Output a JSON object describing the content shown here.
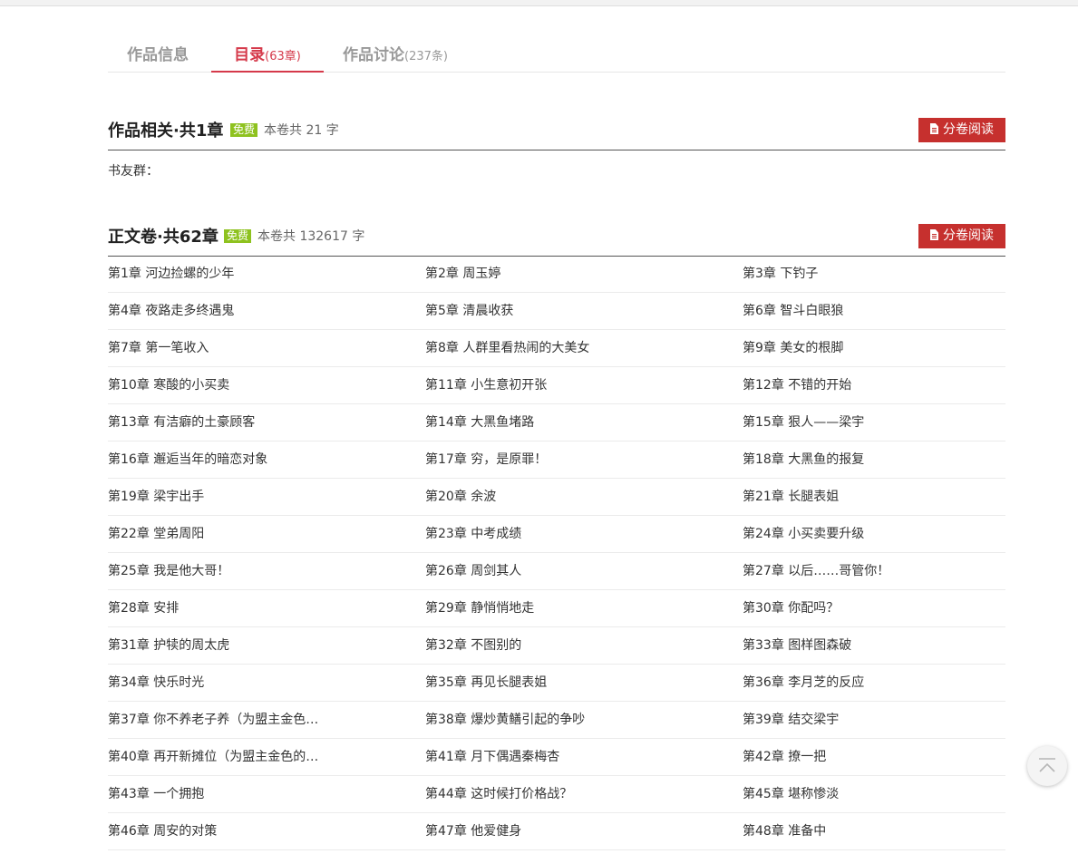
{
  "tabs": [
    {
      "label": "作品信息",
      "count": ""
    },
    {
      "label": "目录",
      "count": "(63章)"
    },
    {
      "label": "作品讨论",
      "count": "(237条)"
    }
  ],
  "volumes": [
    {
      "title": "作品相关·共1章",
      "badge": "免费",
      "info": "本卷共 21 字",
      "button": "分卷阅读",
      "note": "书友群："
    },
    {
      "title": "正文卷·共62章",
      "badge": "免费",
      "info": "本卷共 132617 字",
      "button": "分卷阅读"
    }
  ],
  "chapters": [
    "第1章 河边捡螺的少年",
    "第2章 周玉婷",
    "第3章 下钓子",
    "第4章 夜路走多终遇鬼",
    "第5章 清晨收获",
    "第6章 智斗白眼狼",
    "第7章 第一笔收入",
    "第8章 人群里看热闹的大美女",
    "第9章 美女的根脚",
    "第10章 寒酸的小买卖",
    "第11章 小生意初开张",
    "第12章 不错的开始",
    "第13章 有洁癖的土豪顾客",
    "第14章 大黑鱼堵路",
    "第15章 狠人——梁宇",
    "第16章 邂逅当年的暗恋对象",
    "第17章 穷，是原罪！",
    "第18章 大黑鱼的报复",
    "第19章 梁宇出手",
    "第20章 余波",
    "第21章 长腿表姐",
    "第22章 堂弟周阳",
    "第23章 中考成绩",
    "第24章 小买卖要升级",
    "第25章 我是他大哥！",
    "第26章 周剑其人",
    "第27章 以后……哥管你！",
    "第28章 安排",
    "第29章 静悄悄地走",
    "第30章 你配吗？",
    "第31章 护犊的周太虎",
    "第32章 不图别的",
    "第33章 图样图森破",
    "第34章 快乐时光",
    "第35章 再见长腿表姐",
    "第36章 李月芝的反应",
    "第37章 你不养老子养（为盟主金色…",
    "第38章 爆炒黄鳝引起的争吵",
    "第39章 结交梁宇",
    "第40章 再开新摊位（为盟主金色的…",
    "第41章 月下偶遇秦梅杏",
    "第42章 撩一把",
    "第43章 一个拥抱",
    "第44章 这时候打价格战？",
    "第45章 堪称惨淡",
    "第46章 周安的对策",
    "第47章 他爱健身",
    "第48章 准备中"
  ],
  "icons": {
    "volume_button": "document-icon",
    "back_to_top": "arrow-up-icon"
  },
  "colors": {
    "accent": "#d5394a",
    "button": "#c6302e",
    "badge": "#8ec21f"
  }
}
